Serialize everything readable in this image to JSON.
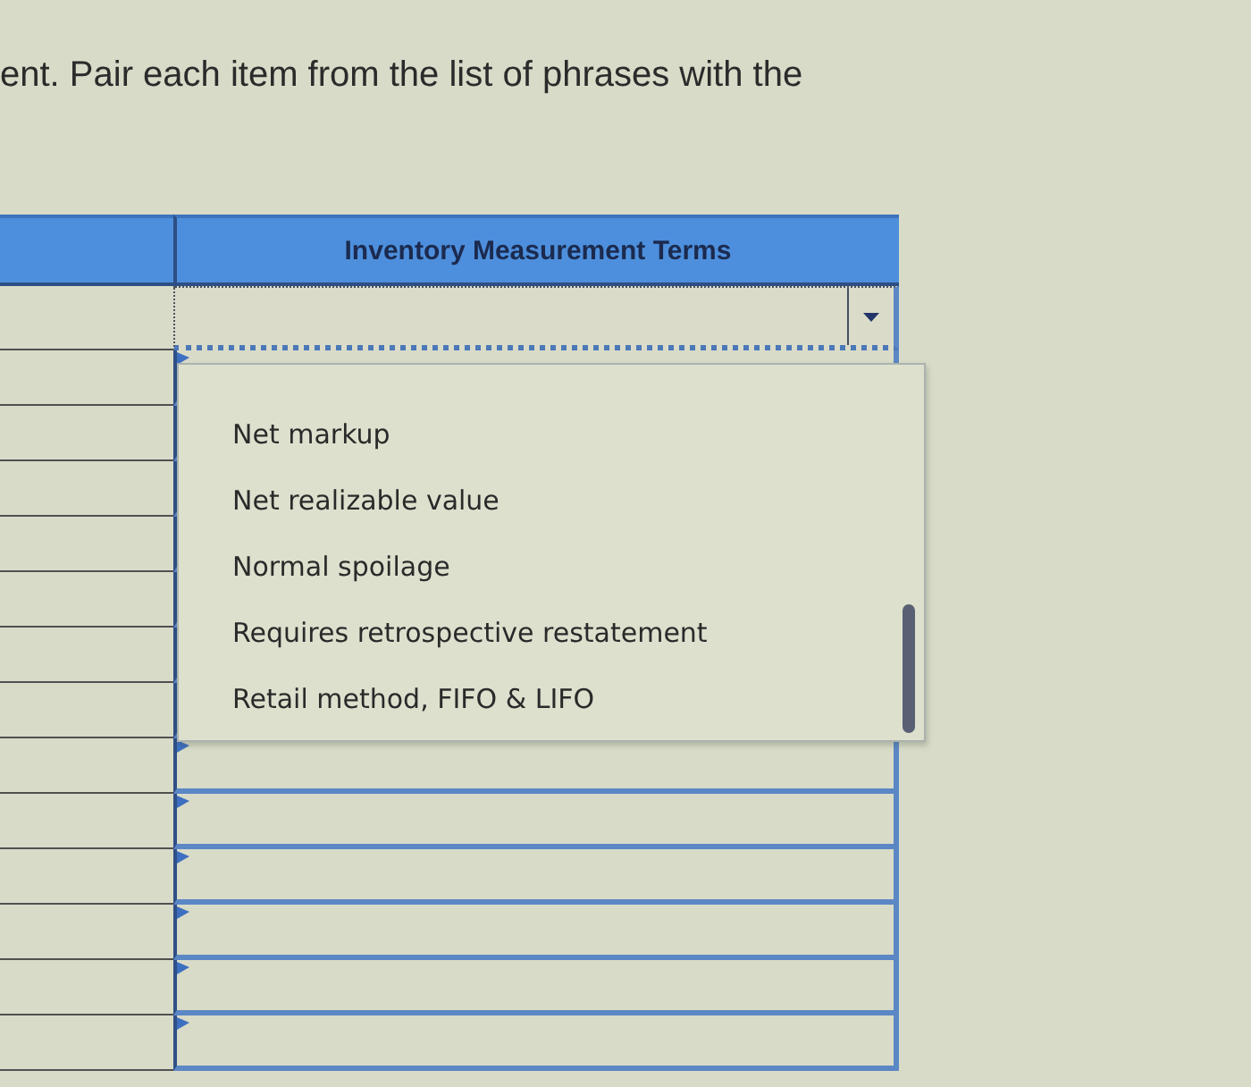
{
  "instruction": "ent. Pair each item from the list of phrases with the",
  "table": {
    "header": "Inventory Measurement Terms",
    "rows": [
      {
        "expanded": true,
        "options": [
          {
            "label": "Net markup",
            "selected": false
          },
          {
            "label": "Net realizable value",
            "selected": false
          },
          {
            "label": "Normal spoilage",
            "selected": false
          },
          {
            "label": "Requires retrospective restatement",
            "selected": false
          },
          {
            "label": "Retail method, FIFO & LIFO",
            "selected": false
          }
        ]
      },
      {
        "expanded": false
      },
      {
        "expanded": false
      },
      {
        "expanded": false
      },
      {
        "expanded": false
      },
      {
        "expanded": false
      },
      {
        "expanded": false
      },
      {
        "expanded": false
      },
      {
        "expanded": false
      },
      {
        "expanded": false
      },
      {
        "expanded": false
      },
      {
        "expanded": false
      },
      {
        "expanded": false
      },
      {
        "expanded": false
      }
    ]
  }
}
